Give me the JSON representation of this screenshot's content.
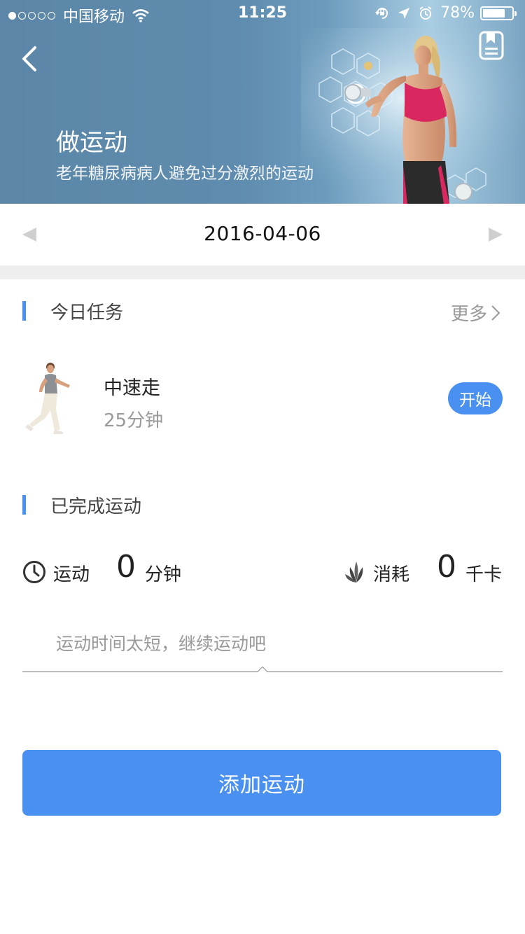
{
  "status_bar": {
    "carrier": "中国移动",
    "time": "11:25",
    "battery_percent": "78%",
    "battery_level": 0.78,
    "signal_icon": "signal-dots-icon",
    "wifi_icon": "wifi-icon"
  },
  "header": {
    "title": "做运动",
    "subtitle": "老年糖尿病病人避免过分激烈的运动",
    "back_icon": "back-chevron-icon",
    "bookmark_icon": "bookmark-icon"
  },
  "date_bar": {
    "date": "2016-04-06",
    "prev_icon": "triangle-left-icon",
    "next_icon": "triangle-right-icon"
  },
  "today_tasks": {
    "title": "今日任务",
    "more_label": "更多",
    "task": {
      "name": "中速走",
      "duration": "25分钟",
      "action_label": "开始"
    }
  },
  "completed": {
    "title": "已完成运动",
    "exercise": {
      "label": "运动",
      "value": "0",
      "unit": "分钟",
      "icon": "clock-icon"
    },
    "consumption": {
      "label": "消耗",
      "value": "0",
      "unit": "千卡",
      "icon": "leaf-flame-icon"
    },
    "hint": "运动时间太短，继续运动吧"
  },
  "add_button": {
    "label": "添加运动"
  },
  "colors": {
    "accent": "#4a90f0",
    "banner": "#5f8cae",
    "muted_text": "#999999",
    "divider": "#eeeeee"
  }
}
